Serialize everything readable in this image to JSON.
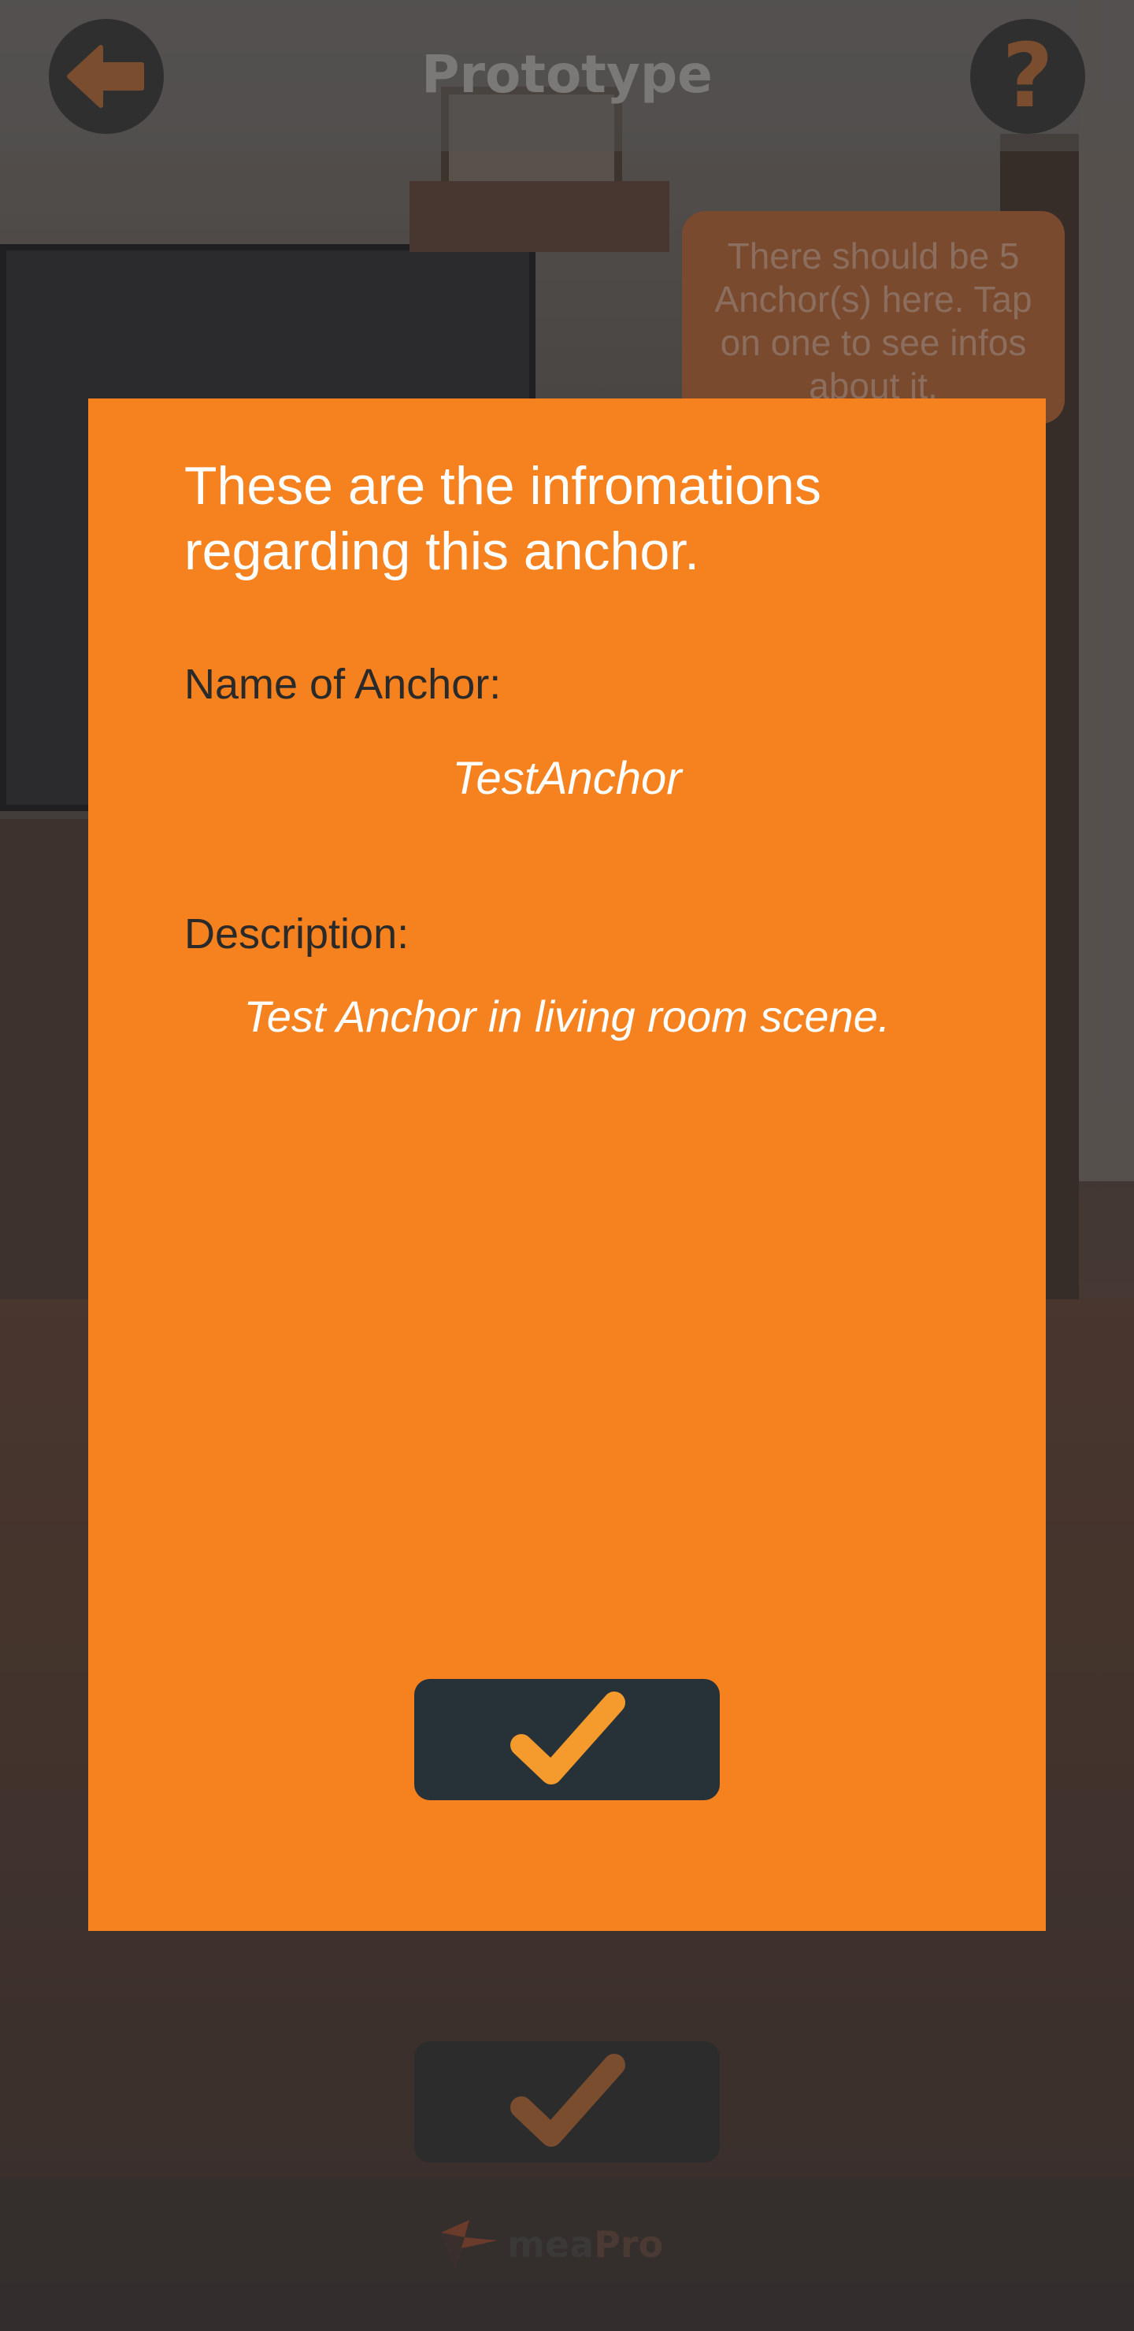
{
  "top_bar": {
    "title": "Prototype",
    "back_icon": "arrow-left-icon",
    "help_icon": "question-mark-icon",
    "help_glyph": "?"
  },
  "hint": {
    "text": "There should be 5 Anchor(s) here. Tap on one to see infos about it."
  },
  "modal": {
    "heading": "These are the infromations regarding this anchor.",
    "name_label": "Name of Anchor:",
    "name_value": "TestAnchor",
    "description_label": "Description:",
    "description_value": "Test Anchor in living room scene.",
    "confirm_icon": "checkmark-icon"
  },
  "footer": {
    "logo_text_primary": "mea",
    "logo_text_secondary": "Pro"
  },
  "colors": {
    "accent_orange": "#f5821f",
    "button_dark": "#263238",
    "checkmark": "#f59a2c",
    "text_dark": "#2a2a2a",
    "text_light": "#ffffff"
  }
}
